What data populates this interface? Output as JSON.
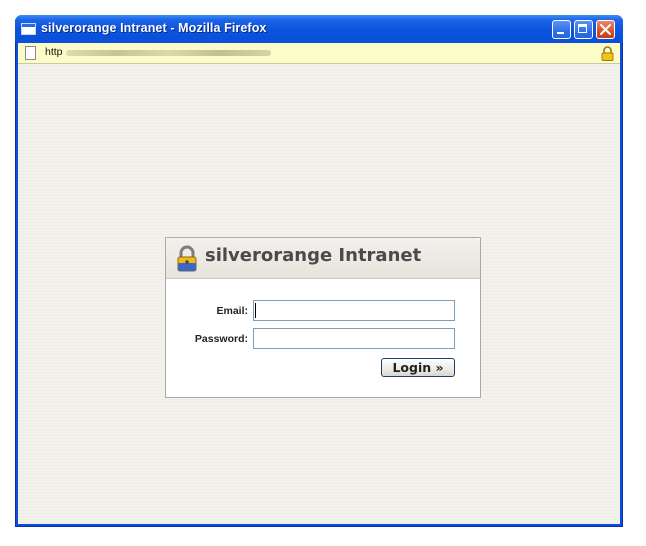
{
  "window": {
    "title": "silverorange Intranet - Mozilla Firefox",
    "buttons": [
      "minimize",
      "maximize",
      "close"
    ]
  },
  "urlbar": {
    "url_visible_prefix": "http",
    "secure": true,
    "background_color": "#fcfcc8"
  },
  "login": {
    "title": "silverorange Intranet",
    "email_label": "Email:",
    "email_value": "",
    "password_label": "Password:",
    "password_value": "",
    "submit_label": "Login »"
  },
  "icons": {
    "app": "firefox-window-icon",
    "page": "page-icon",
    "secure": "padlock-icon",
    "panel": "padlock-icon"
  },
  "colors": {
    "titlebar_blue": "#0a4fd8",
    "page_background": "#f2f0ea",
    "input_border": "#7f9db9"
  }
}
